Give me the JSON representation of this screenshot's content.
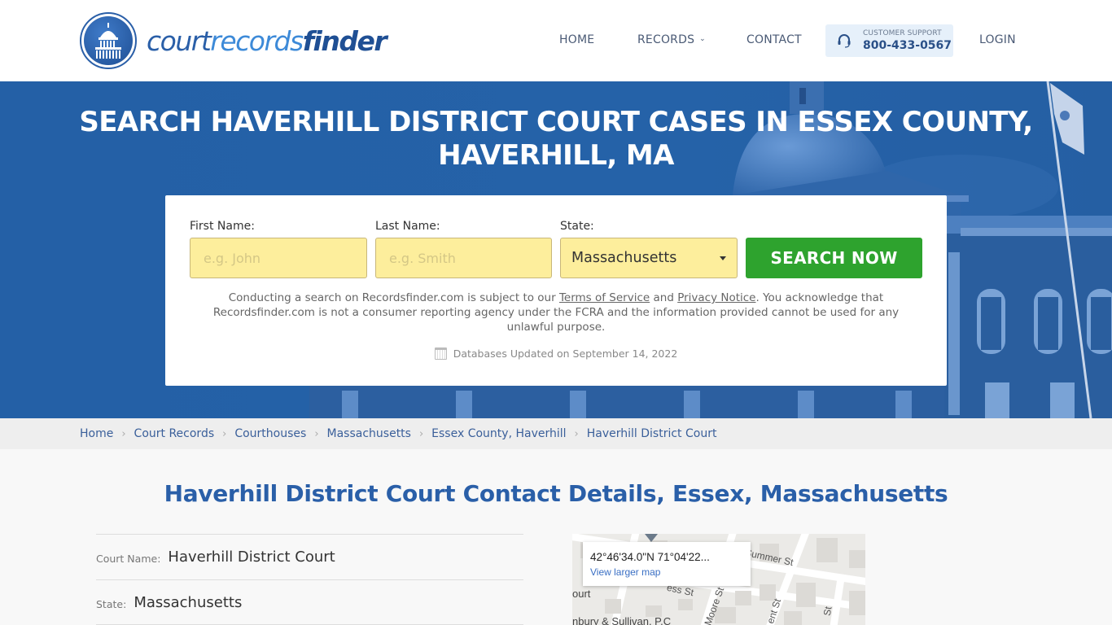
{
  "brand": {
    "logo_part1": "court",
    "logo_part2": "records",
    "logo_part3": "finder",
    "colors": {
      "primary": "#2a5fa8",
      "accent_green": "#2ea32e",
      "input_yellow": "#fdee9c"
    }
  },
  "nav": {
    "home": "HOME",
    "records": "RECORDS",
    "contact": "CONTACT",
    "support_label": "CUSTOMER SUPPORT",
    "support_phone": "800-433-0567",
    "login": "LOGIN"
  },
  "hero": {
    "title_line1": "SEARCH HAVERHILL DISTRICT COURT CASES IN ESSEX COUNTY,",
    "title_line2": "HAVERHILL, MA"
  },
  "search": {
    "first_name_label": "First Name:",
    "first_name_placeholder": "e.g. John",
    "first_name_value": "",
    "last_name_label": "Last Name:",
    "last_name_placeholder": "e.g. Smith",
    "last_name_value": "",
    "state_label": "State:",
    "state_value": "Massachusetts",
    "button": "SEARCH NOW",
    "disclaimer_pre": "Conducting a search on Recordsfinder.com is subject to our ",
    "terms_link": "Terms of Service",
    "disclaimer_and": " and ",
    "privacy_link": "Privacy Notice",
    "disclaimer_post": ". You acknowledge that Recordsfinder.com is not a consumer reporting agency under the FCRA and the information provided cannot be used for any unlawful purpose.",
    "db_updated": "Databases Updated on September 14, 2022"
  },
  "breadcrumb": [
    {
      "label": "Home"
    },
    {
      "label": "Court Records"
    },
    {
      "label": "Courthouses"
    },
    {
      "label": "Massachusetts"
    },
    {
      "label": "Essex County, Haverhill"
    },
    {
      "label": "Haverhill District Court"
    }
  ],
  "main": {
    "title": "Haverhill District Court Contact Details, Essex, Massachusetts",
    "details": [
      {
        "label": "Court Name:",
        "value": "Haverhill District Court"
      },
      {
        "label": "State:",
        "value": "Massachusetts"
      }
    ]
  },
  "map": {
    "coords": "42°46'34.0\"N 71°04'22...",
    "view_larger": "View larger map",
    "labels": {
      "summer_st": "Summer St",
      "ess_st": "ess St",
      "moore_st": "Moore St",
      "kent_st": "ent St",
      "st": "St",
      "court_partial": "ourt",
      "business_partial": "nbury & Sullivan, P.C"
    }
  }
}
